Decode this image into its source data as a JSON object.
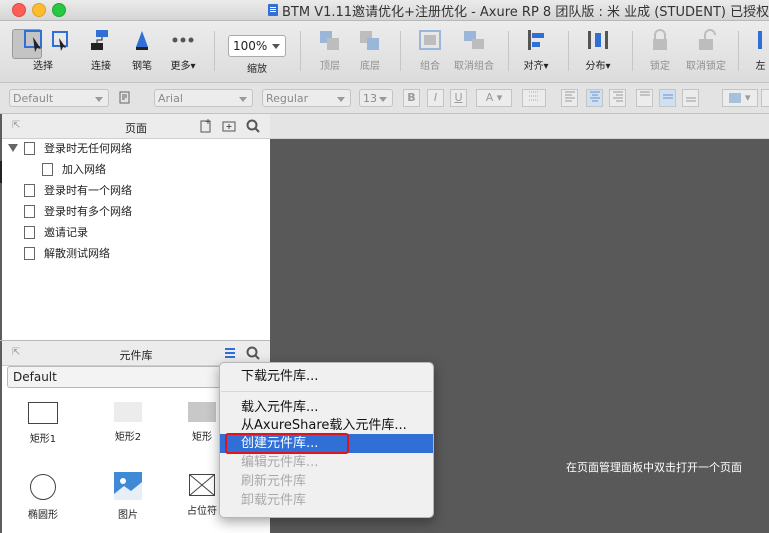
{
  "window": {
    "title": "BTM V1.11邀请优化+注册优化 - Axure RP 8 团队版 : 米 业成 (STUDENT) 已授权"
  },
  "toolbar": {
    "select": "选择",
    "connect": "连接",
    "pen": "钢笔",
    "more": "更多▾",
    "zoom_value": "100%",
    "zoom": "缩放",
    "top_layer": "顶层",
    "bottom_layer": "底层",
    "group": "组合",
    "ungroup": "取消组合",
    "align": "对齐▾",
    "distribute": "分布▾",
    "lock": "锁定",
    "unlock": "取消锁定",
    "left_cut": "左"
  },
  "format": {
    "style": "Default",
    "font": "Arial",
    "weight": "Regular",
    "size": "13",
    "bold": "B",
    "italic": "I",
    "underline": "U",
    "color_a": "A"
  },
  "pages_panel": {
    "title": "页面",
    "items": [
      {
        "label": "登录时无任何网络"
      },
      {
        "label": "加入网络"
      },
      {
        "label": "登录时有一个网络"
      },
      {
        "label": "登录时有多个网络"
      },
      {
        "label": "邀请记录"
      },
      {
        "label": "解散测试网络"
      }
    ]
  },
  "library_panel": {
    "title": "元件库",
    "selected": "Default",
    "widgets": [
      {
        "label": "矩形1"
      },
      {
        "label": "矩形2"
      },
      {
        "label": "矩形"
      },
      {
        "label": "椭圆形"
      },
      {
        "label": "图片"
      },
      {
        "label": "占位符"
      }
    ]
  },
  "context_menu": {
    "items": [
      {
        "label": "下载元件库...",
        "state": "enabled"
      },
      {
        "label": "载入元件库...",
        "state": "enabled"
      },
      {
        "label": "从AxureShare载入元件库...",
        "state": "enabled"
      },
      {
        "label": "创建元件库...",
        "state": "highlighted"
      },
      {
        "label": "编辑元件库...",
        "state": "disabled"
      },
      {
        "label": "刷新元件库",
        "state": "disabled"
      },
      {
        "label": "卸载元件库",
        "state": "disabled"
      }
    ]
  },
  "canvas": {
    "hint": "在页面管理面板中双击打开一个页面"
  },
  "colors": {
    "highlight": "#2f6fd6",
    "annotation": "#e0141f",
    "canvas": "#595959"
  }
}
